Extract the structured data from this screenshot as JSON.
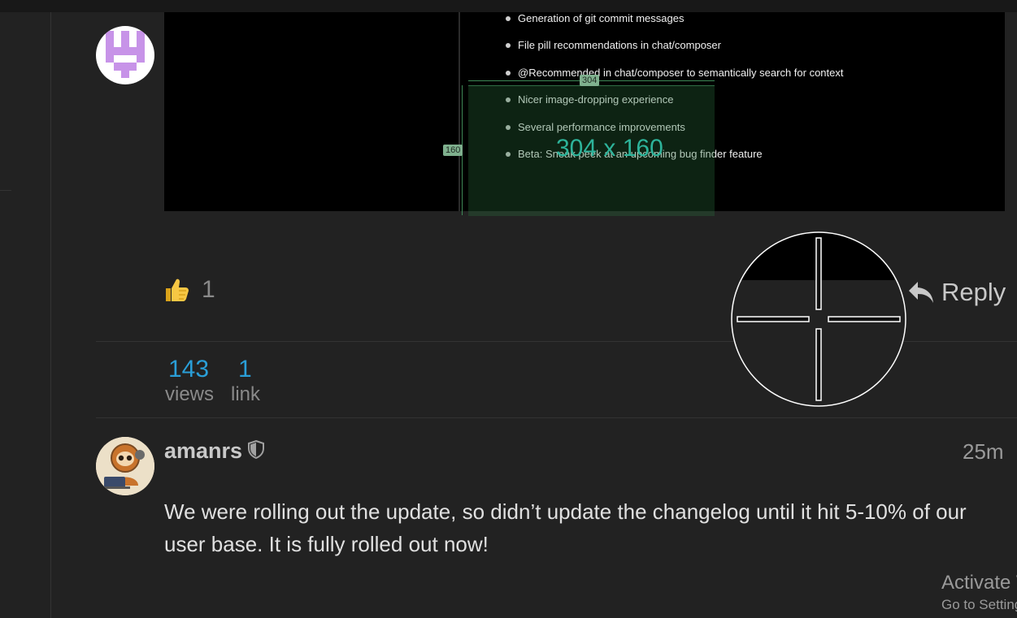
{
  "topic": {
    "image_list": [
      "Generation of git commit messages",
      "File pill recommendations in chat/composer",
      "@Recommended in chat/composer to semantically search for context",
      "Nicer image-dropping experience",
      "Several performance improvements",
      "Beta: Sneak peek at an upcoming bug finder feature"
    ],
    "measure": {
      "width_label": "304",
      "height_label": "160",
      "readout": "304 x 160"
    },
    "likes": "1",
    "reply_label": "Reply",
    "views_count": "143",
    "views_label": "views",
    "links_count": "1",
    "links_label": "link"
  },
  "reply_post": {
    "username": "amanrs",
    "time": "25m",
    "body": "We were rolling out the update, so didn’t update the changelog until it hit 5-10% of our user base. It is fully rolled out now!"
  },
  "activation": {
    "title": "Activate Windows",
    "subtitle": "Go to Settings to activate Windows."
  },
  "colors": {
    "background": "#222222",
    "link_blue": "#2a9fd8",
    "measure_green": "#2db39a",
    "avatar_purple": "#c793e8"
  },
  "icons": [
    "thumbs-up-icon",
    "reply-arrow-icon",
    "shield-icon",
    "crosshair-icon"
  ]
}
